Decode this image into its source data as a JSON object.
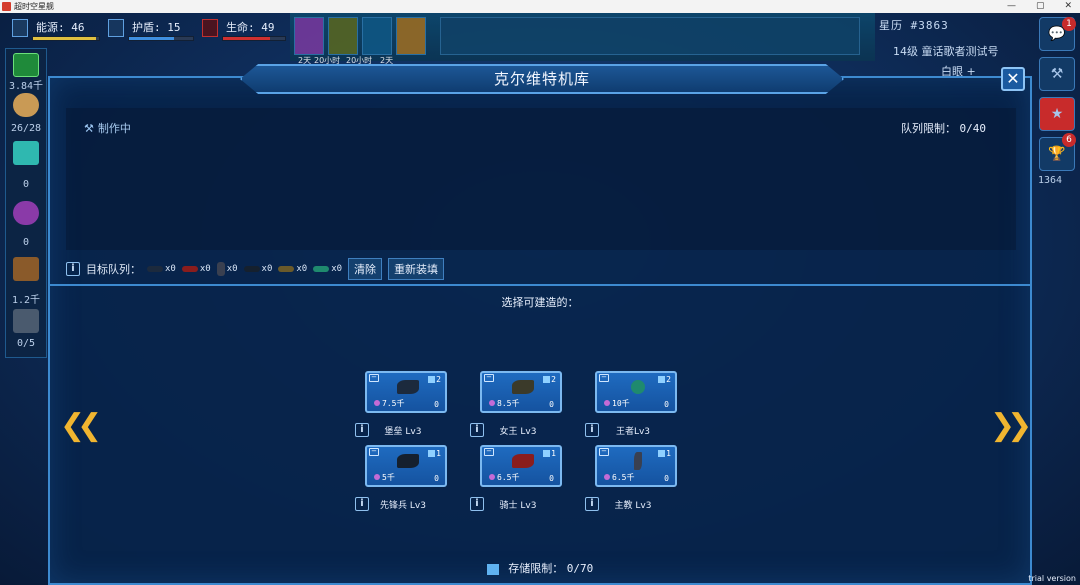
{
  "window": {
    "title": "超时空星舰"
  },
  "hud": {
    "energy_label": "能源: 46",
    "shield_label": "护盾: 15",
    "life_label": "生命: 49",
    "timers": [
      "2天",
      "20小时",
      "20小时",
      "2天"
    ],
    "energy_fill": 0.95,
    "shield_fill": 0.7,
    "life_fill": 0.75
  },
  "top_right": {
    "star_calendar": "星历 #3863",
    "level_text": "14级  童话歌者测试号",
    "white_eye": "白眼 +"
  },
  "left_sidebar": {
    "credits": "3.84千",
    "crew": "26/28",
    "crystals": "0",
    "orbs": "0",
    "crates": "1.2千",
    "factory": "0/5"
  },
  "right_sidebar": {
    "chat_badge": "1",
    "trophy_badge": "6",
    "score": "1364"
  },
  "dialog": {
    "title": "克尔维特机库",
    "crafting_label": "制作中",
    "queue_limit_label": "队列限制：",
    "queue_limit_value": "0/40",
    "target_queue_label": "目标队列：",
    "target_counts": [
      "x0",
      "x0",
      "x0",
      "x0",
      "x0",
      "x0"
    ],
    "clear_button": "清除",
    "refill_button": "重新装填",
    "select_label": "选择可建造的：",
    "storage_label": "存储限制：",
    "storage_value": "0/70"
  },
  "ships": [
    {
      "name": "堡垒 Lv3",
      "cost": "7.5千",
      "slots": "2",
      "count": "0",
      "color": "#1c2a3d"
    },
    {
      "name": "女王 Lv3",
      "cost": "8.5千",
      "slots": "2",
      "count": "0",
      "color": "#3b3a2a"
    },
    {
      "name": "王者Lv3",
      "cost": "10千",
      "slots": "2",
      "count": "0",
      "color": "#1f8a6e"
    },
    {
      "name": "先锋兵 Lv3",
      "cost": "5千",
      "slots": "1",
      "count": "0",
      "color": "#15202e"
    },
    {
      "name": "骑士 Lv3",
      "cost": "6.5千",
      "slots": "1",
      "count": "0",
      "color": "#8a1d1d"
    },
    {
      "name": "主教 Lv3",
      "cost": "6.5千",
      "slots": "1",
      "count": "0",
      "color": "#3a4050"
    }
  ],
  "footer": {
    "trial": "trial version"
  },
  "colors": {
    "accent": "#3d8ad0",
    "arrow": "#f0b530",
    "energy": "#e0c040",
    "shield": "#3f8fe0",
    "life": "#d03030"
  }
}
